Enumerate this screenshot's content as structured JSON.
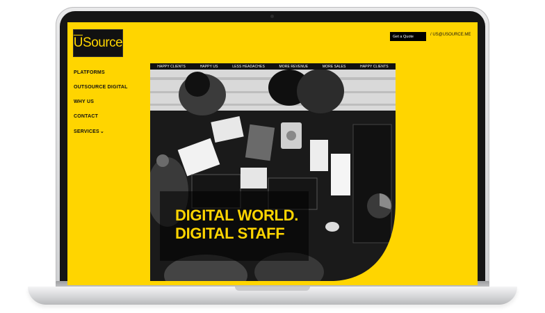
{
  "brand": {
    "logo_text": "USource"
  },
  "header": {
    "quote_button": "Get a Quote",
    "email": "/  US@USOURCE.ME"
  },
  "sidebar": {
    "items": [
      {
        "label": "PLATFORMS"
      },
      {
        "label": "OUTSOURCE DIGITAL"
      },
      {
        "label": "WHY US"
      },
      {
        "label": "CONTACT"
      },
      {
        "label": "SERVICES"
      }
    ]
  },
  "hero": {
    "tabs": [
      {
        "label": "HAPPY CLIENTS"
      },
      {
        "label": "HAPPY US"
      },
      {
        "label": "LESS HEADACHES"
      },
      {
        "label": "MORE REVENUE"
      },
      {
        "label": "MORE SALES"
      },
      {
        "label": "HAPPY CLIENTS"
      }
    ],
    "headline_line1": "DIGITAL WORLD.",
    "headline_line2": "DIGITAL STAFF",
    "image_alt": "Overhead black and white photo of team working at a desk with laptops, tablets and charts"
  },
  "colors": {
    "brand_yellow": "#ffd500",
    "dark": "#111111"
  }
}
